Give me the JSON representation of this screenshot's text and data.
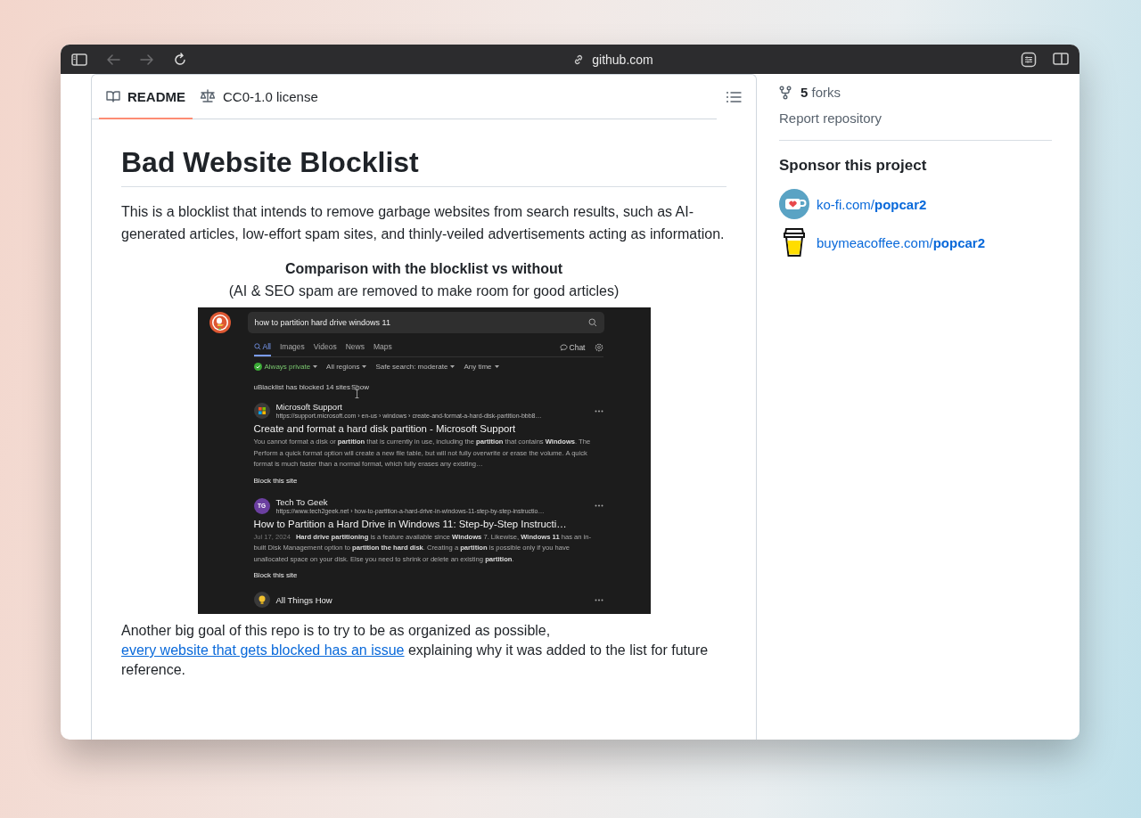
{
  "browser": {
    "address": "github.com",
    "back_disabled": true,
    "forward_disabled": true
  },
  "readme": {
    "tabs": [
      {
        "label": "README",
        "selected": true
      },
      {
        "label": "CC0-1.0 license",
        "selected": false
      }
    ],
    "title": "Bad Website Blocklist",
    "intro": "This is a blocklist that intends to remove garbage websites from search results, such as AI-generated articles, low-effort spam sites, and thinly-veiled advertisements acting as information.",
    "comparison_heading": "Comparison with the blocklist vs without",
    "comparison_note": "(AI & SEO spam are removed to make room for good articles)",
    "screenshot": {
      "query": "how to partition hard drive windows 11",
      "nav": [
        {
          "label": "All",
          "selected": true
        },
        {
          "label": "Images",
          "selected": false
        },
        {
          "label": "Videos",
          "selected": false
        },
        {
          "label": "News",
          "selected": false
        },
        {
          "label": "Maps",
          "selected": false
        }
      ],
      "chat": "Chat",
      "filters": [
        {
          "label": "Always private",
          "kind": "privacy"
        },
        {
          "label": "All regions",
          "kind": "dropdown"
        },
        {
          "label": "Safe search: moderate",
          "kind": "dropdown"
        },
        {
          "label": "Any time",
          "kind": "dropdown"
        }
      ],
      "blocked_note": "uBlacklist has blocked 14 sites",
      "show": "Show",
      "results": [
        {
          "kind": "tiles",
          "site": "Microsoft Support",
          "url": "https://support.microsoft.com › en-us › windows › create-and-format-a-hard-disk-partition-bbb8…",
          "title": "Create and format a hard disk partition - Microsoft Support",
          "snippet": "You cannot format a disk or **partition** that is currently in use, including the **partition** that contains **Windows**. The Perform a quick format option will create a new file table, but will not fully overwrite or erase the volume. A quick format is much faster than a normal format, which fully erases any existing…",
          "block": "Block this site"
        },
        {
          "kind": "initials",
          "initials": "TG",
          "site": "Tech To Geek",
          "url": "https://www.tech2geek.net › how-to-partition-a-hard-drive-in-windows-11-step-by-step-instructio…",
          "title": "How to Partition a Hard Drive in Windows 11: Step-by-Step Instructi…",
          "date": "Jul 17, 2024",
          "snippet": "**Hard drive partitioning** is a feature available since **Windows** 7. Likewise, **Windows 11** has an in-built Disk Management option to **partition the hard disk**. Creating a **partition** is possible only if you have unallocated space on your disk. Else you need to shrink or delete an existing **partition**.",
          "block": "Block this site"
        },
        {
          "kind": "bulb",
          "site": "All Things How"
        }
      ]
    },
    "closing": {
      "before": "Another big goal of this repo is to try to be as organized as possible,",
      "link": "every website that gets blocked has an issue",
      "after": "explaining why it was added to the list for future reference."
    }
  },
  "sidebar": {
    "forks_count": "5",
    "forks_label": "forks",
    "report": "Report repository",
    "sponsor_title": "Sponsor this project",
    "sponsors": [
      {
        "kind": "kofi",
        "link": "ko-fi.com/**popcar2**"
      },
      {
        "kind": "coffee",
        "link": "buymeacoffee.com/**popcar2**"
      }
    ]
  }
}
